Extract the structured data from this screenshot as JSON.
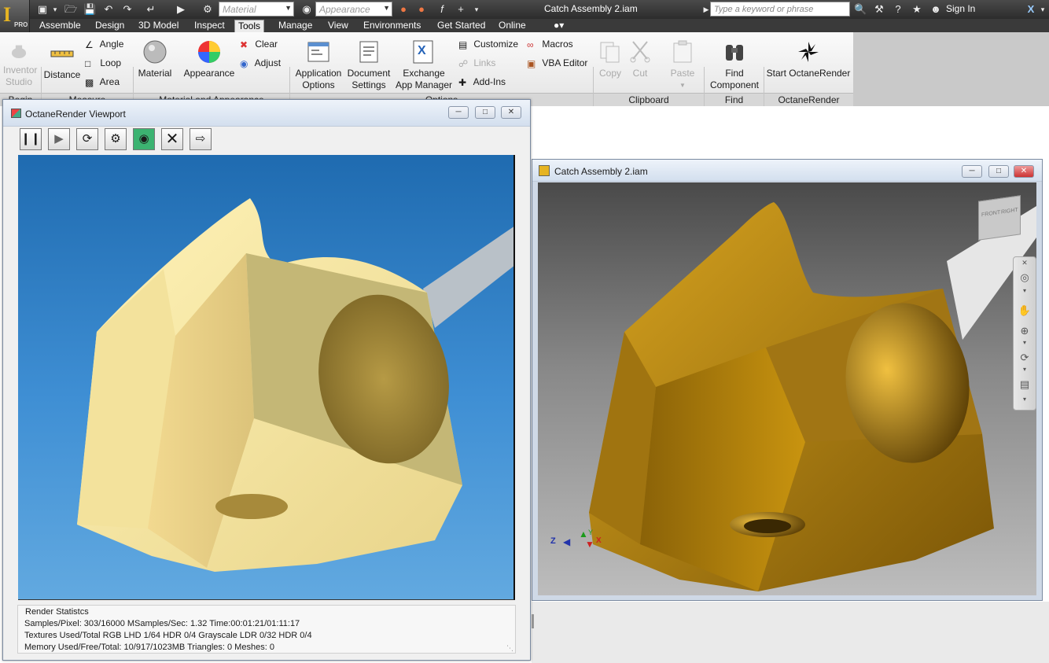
{
  "app": {
    "product": "PRO",
    "document_title": "Catch Assembly 2.iam",
    "material_combo": "Material",
    "appearance_combo": "Appearance",
    "search_placeholder": "Type a keyword or phrase",
    "sign_in": "Sign In"
  },
  "tabs": [
    "Assemble",
    "Design",
    "3D Model",
    "Inspect",
    "Tools",
    "Manage",
    "View",
    "Environments",
    "Get Started",
    "Online"
  ],
  "active_tab": "Tools",
  "ribbon": {
    "begin": {
      "inventor_studio": "Inventor Studio",
      "panel": "Begin"
    },
    "measure": {
      "distance": "Distance",
      "angle": "Angle",
      "loop": "Loop",
      "area": "Area",
      "panel": "Measure"
    },
    "material": {
      "material": "Material",
      "appearance": "Appearance",
      "clear": "Clear",
      "adjust": "Adjust",
      "panel": "Material and Appearance"
    },
    "options": {
      "app_options_1": "Application",
      "app_options_2": "Options",
      "doc_settings_1": "Document",
      "doc_settings_2": "Settings",
      "exchange_1": "Exchange",
      "exchange_2": "App Manager",
      "customize": "Customize",
      "links": "Links",
      "addins": "Add-Ins",
      "macros": "Macros",
      "vba": "VBA Editor",
      "panel": "Options"
    },
    "clipboard": {
      "copy": "Copy",
      "cut": "Cut",
      "paste": "Paste",
      "panel": "Clipboard"
    },
    "find": {
      "find_1": "Find",
      "find_2": "Component",
      "panel": "Find"
    },
    "octane": {
      "start": "Start OctaneRender",
      "panel": "OctaneRender"
    }
  },
  "octane_window": {
    "title": "OctaneRender Viewport",
    "toolbar": [
      "pause",
      "play",
      "restart",
      "settings",
      "active-render",
      "stop",
      "export"
    ],
    "stats": {
      "header": "Render Statistcs",
      "line1": "Samples/Pixel: 303/16000  MSamples/Sec: 1.32  Time:00:01:21/01:11:17",
      "line2": "Textures Used/Total RGB LHD 1/64  HDR 0/4  Grayscale LDR 0/32  HDR 0/4",
      "line3": "Memory Used/Free/Total: 10/917/1023MB  Triangles: 0  Meshes:  0"
    }
  },
  "catch_window": {
    "title": "Catch Assembly 2.iam",
    "viewcube": {
      "face1": "FRONT",
      "face2": "RIGHT"
    },
    "triad": {
      "x": "X",
      "y": "Y",
      "z": "Z"
    }
  },
  "colors": {
    "render_bg": "#3f8fd4",
    "part_render": "#f2e3a0",
    "part_inventor": "#b8860b"
  }
}
